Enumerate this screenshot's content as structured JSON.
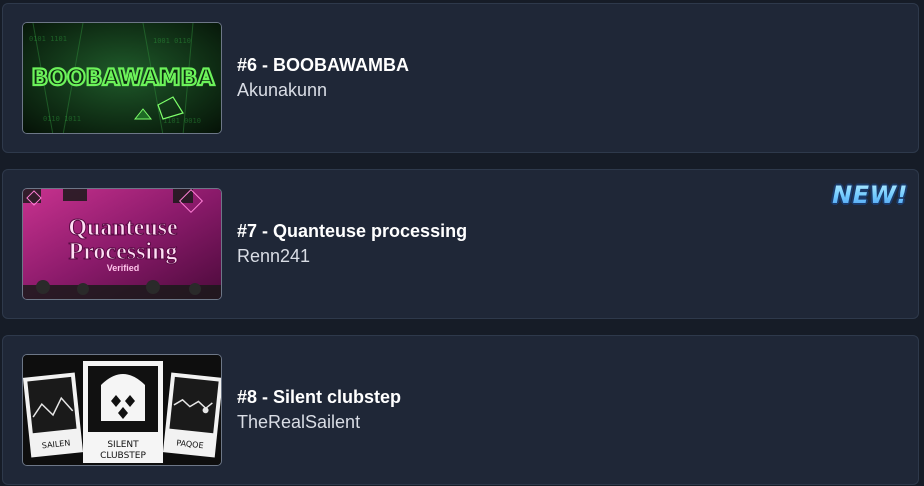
{
  "levels": [
    {
      "title": "#6 - BOOBAWAMBA",
      "creator": "Akunakunn",
      "thumbnail_text": "BOOBAWAMBA",
      "thumbnail_colors": {
        "bg": "#0d2a14",
        "text": "#55e04a",
        "accent": "#1a7a2a"
      }
    },
    {
      "title": "#7 - Quanteuse processing",
      "creator": "Renn241",
      "badge": "NEW!",
      "thumbnail_text": [
        "Quanteuse",
        "Processing",
        "Verified"
      ],
      "thumbnail_colors": {
        "bg": "#8a1a6a",
        "text": "#ffd4f2",
        "accent": "#e03ab0"
      }
    },
    {
      "title": "#8 - Silent clubstep",
      "creator": "TheRealSailent",
      "thumbnail_text": [
        "SILENT",
        "CLUBSTEP",
        "SAILEN",
        "PAQOE"
      ],
      "thumbnail_colors": {
        "bg": "#111111",
        "text": "#111111",
        "accent": "#ffffff"
      }
    }
  ]
}
